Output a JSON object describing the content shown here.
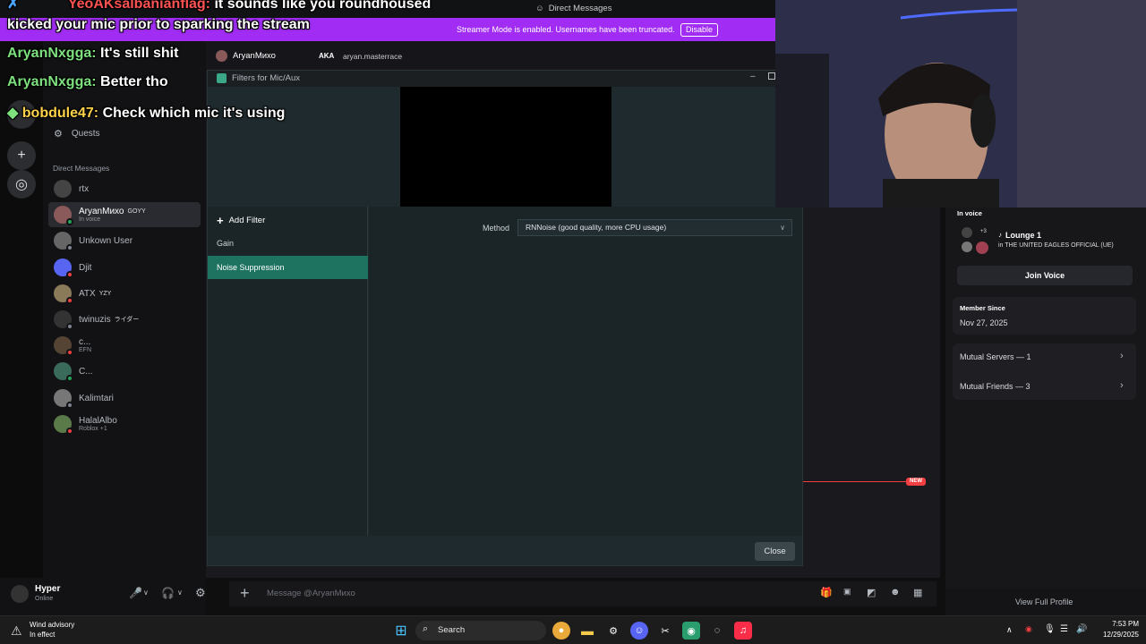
{
  "window": {
    "title": "Direct Messages"
  },
  "streamer_mode": {
    "message": "Streamer Mode is enabled. Usernames have been truncated.",
    "button": "Disable"
  },
  "header": {
    "name": "AryanМихо",
    "aka_label": "AKA",
    "username": "aryan.masterrace"
  },
  "stream_chat": [
    {
      "user": "YeoAKsalbanianflag:",
      "text": "it sounds like you roundhoused"
    },
    {
      "user": "",
      "text": "kicked your mic prior to sparking the stream"
    },
    {
      "user": "AryanNxgga:",
      "text": "It's still shit"
    },
    {
      "user": "AryanNxgga:",
      "text": "Better tho"
    },
    {
      "user": "bobdule47:",
      "text": "Check which mic it's using"
    }
  ],
  "sidebar": {
    "quests": "Quests",
    "dm_header": "Direct Messages",
    "dms": [
      {
        "name": "rtx",
        "sub": "",
        "tag": "",
        "avatar_color": "#444"
      },
      {
        "name": "AryanМихо",
        "sub": "In voice",
        "tag": "GOYY",
        "avatar_color": "#8a5a5a"
      },
      {
        "name": "Unkown User",
        "sub": "",
        "tag": "",
        "avatar_color": "#666"
      },
      {
        "name": "Djit",
        "sub": "",
        "tag": "",
        "avatar_color": "#5865f2"
      },
      {
        "name": "ATX",
        "sub": "",
        "tag": "YZY",
        "avatar_color": "#8a7a5a"
      },
      {
        "name": "twinuzis",
        "sub": "",
        "tag": "ライダー",
        "avatar_color": "#333"
      },
      {
        "name": "c...",
        "sub": "EFN",
        "tag": "",
        "avatar_color": "#554433"
      },
      {
        "name": "C...",
        "sub": "",
        "tag": "",
        "avatar_color": "#3a6a5a"
      },
      {
        "name": "Kalimtari",
        "sub": "",
        "tag": "",
        "avatar_color": "#777"
      },
      {
        "name": "HalalAlbo",
        "sub": "Roblox +1",
        "tag": "",
        "avatar_color": "#5a7a4a"
      }
    ]
  },
  "filters_dialog": {
    "title": "Filters for Mic/Aux",
    "add_filter": "Add Filter",
    "filters": [
      "Gain",
      "Noise Suppression"
    ],
    "selected_filter": "Noise Suppression",
    "method_label": "Method",
    "method_value": "RNNoise (good quality, more CPU usage)",
    "close": "Close"
  },
  "profile": {
    "in_voice_label": "In voice",
    "channel": "Lounge 1",
    "server": "in THE UNITED EAGLES OFFICIAL (UE)",
    "voice_count": "+3",
    "join_voice": "Join Voice",
    "member_since_label": "Member Since",
    "member_since": "Nov 27, 2025",
    "mutual_servers": "Mutual Servers — 1",
    "mutual_friends": "Mutual Friends — 3",
    "view_full": "View Full Profile"
  },
  "new_badge": "NEW",
  "user": {
    "name": "Hyper",
    "status": "Online"
  },
  "composer": {
    "placeholder": "Message @AryanМихо"
  },
  "taskbar": {
    "weather_title": "Wind advisory",
    "weather_sub": "In effect",
    "search": "Search",
    "time": "7:53 PM",
    "date": "12/29/2025"
  }
}
